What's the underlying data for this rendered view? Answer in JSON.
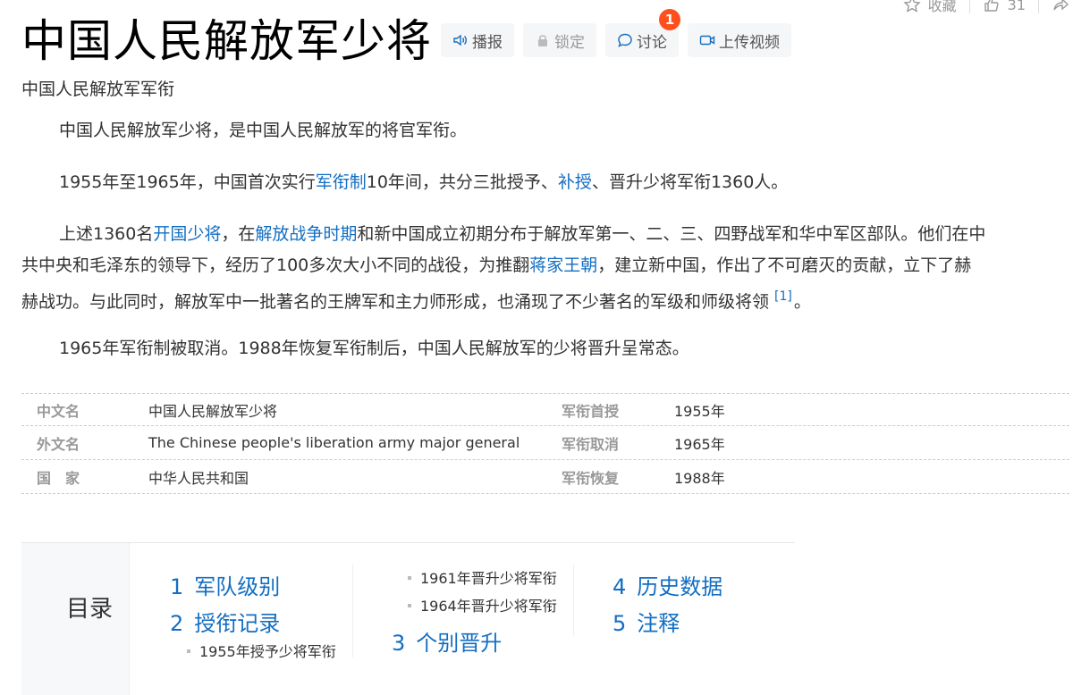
{
  "header": {
    "title": "中国人民解放军少将",
    "subtitle": "中国人民解放军军衔",
    "actions": [
      {
        "label": "播报",
        "icon": "speaker-icon",
        "disabled": false
      },
      {
        "label": "锁定",
        "icon": "lock-icon",
        "disabled": true
      },
      {
        "label": "讨论",
        "icon": "chat-bubble-icon",
        "disabled": false,
        "badge": "1"
      },
      {
        "label": "上传视频",
        "icon": "video-camera-icon",
        "disabled": false
      }
    ],
    "top_right": {
      "favorite_label": "收藏",
      "like_count": "31"
    }
  },
  "content": {
    "p1": "中国人民解放军少将，是中国人民解放军的将官军衔。",
    "p2": {
      "t1": "1955年至1965年，中国首次实行",
      "l1": "军衔制",
      "t2": "10年间，共分三批授予、",
      "l2": "补授",
      "t3": "、晋升少将军衔1360人。"
    },
    "p3": {
      "t1": "上述1360名",
      "l1": "开国少将",
      "t2": "，在",
      "l2": "解放战争时期",
      "t3": "和新中国成立初期分布于解放军第一、二、三、四野战军和华中军区部队。他们在中",
      "line2a": "共中央和毛泽东的领导下，经历了100多次大小不同的战役，为推翻",
      "l3": "蒋家王朝",
      "line2b": "，建立新中国，作出了不可磨灭的贡献，立下了赫",
      "line3": "赫战功。与此同时，解放军中一批著名的王牌军和主力师形成，也涌现了不少著名的军级和师级将领",
      "ref": "[1]",
      "end": "。"
    },
    "p4": "1965年军衔制被取消。1988年恢复军衔制后，中国人民解放军的少将晋升呈常态。"
  },
  "basic_info": [
    {
      "k1": "中文名",
      "v1": "中国人民解放军少将",
      "k2": "军衔首授",
      "v2": "1955年"
    },
    {
      "k1": "外文名",
      "v1": "The Chinese people's liberation army major general",
      "k2": "军衔取消",
      "v2": "1965年"
    },
    {
      "k1": "国　家",
      "v1": "中华人民共和国",
      "k2": "军衔恢复",
      "v2": "1988年"
    }
  ],
  "catalog": {
    "title": "目录",
    "items": [
      {
        "num": "1",
        "label": "军队级别"
      },
      {
        "num": "2",
        "label": "授衔记录"
      },
      {
        "num": "3",
        "label": "个别晋升"
      },
      {
        "num": "4",
        "label": "历史数据"
      },
      {
        "num": "5",
        "label": "注释"
      }
    ],
    "sub_items": [
      "1955年授予少将军衔",
      "1961年晋升少将军衔",
      "1964年晋升少将军衔"
    ]
  }
}
